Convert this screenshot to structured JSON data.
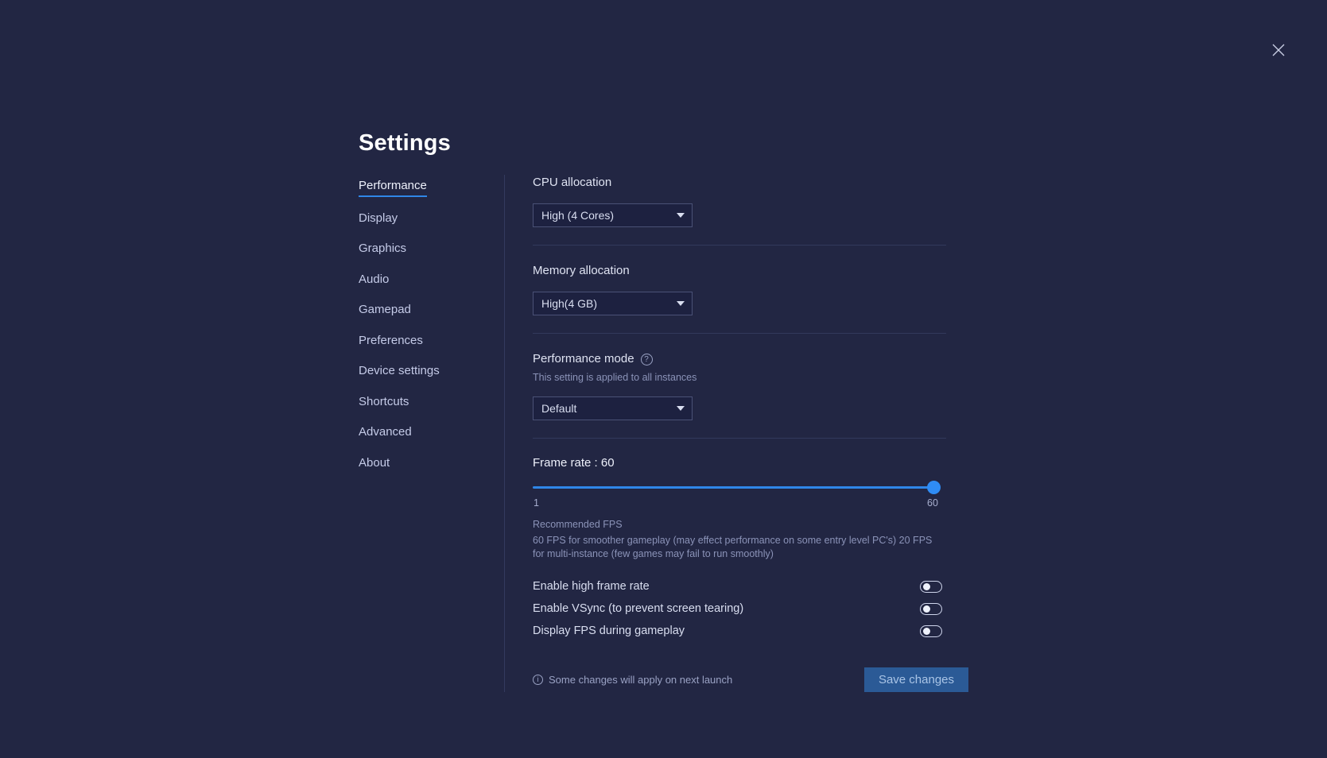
{
  "window": {
    "title": "Settings",
    "close_icon": "close-icon"
  },
  "sidebar": {
    "items": [
      {
        "label": "Performance",
        "active": true
      },
      {
        "label": "Display",
        "active": false
      },
      {
        "label": "Graphics",
        "active": false
      },
      {
        "label": "Audio",
        "active": false
      },
      {
        "label": "Gamepad",
        "active": false
      },
      {
        "label": "Preferences",
        "active": false
      },
      {
        "label": "Device settings",
        "active": false
      },
      {
        "label": "Shortcuts",
        "active": false
      },
      {
        "label": "Advanced",
        "active": false
      },
      {
        "label": "About",
        "active": false
      }
    ]
  },
  "content": {
    "cpu": {
      "label": "CPU allocation",
      "value": "High (4 Cores)"
    },
    "memory": {
      "label": "Memory allocation",
      "value": "High(4 GB)"
    },
    "performance_mode": {
      "label": "Performance mode",
      "help_icon": "question-mark-icon",
      "note": "This setting is applied to all instances",
      "value": "Default"
    },
    "frame_rate": {
      "title": "Frame rate : 60",
      "value": 60,
      "min": 1,
      "max": 60,
      "min_label": "1",
      "max_label": "60",
      "recommended_title": "Recommended FPS",
      "recommended_desc": "60 FPS for smoother gameplay (may effect performance on some entry level PC's) 20 FPS for multi-instance (few games may fail to run smoothly)"
    },
    "toggles": [
      {
        "label": "Enable high frame rate",
        "on": false
      },
      {
        "label": "Enable VSync (to prevent screen tearing)",
        "on": false
      },
      {
        "label": "Display FPS during gameplay",
        "on": false
      }
    ],
    "footer": {
      "info_icon": "info-icon",
      "note": "Some changes will apply on next launch",
      "save_label": "Save changes"
    }
  },
  "colors": {
    "background": "#222643",
    "accent": "#2f86e8",
    "save_button_bg": "#2b5a96"
  }
}
